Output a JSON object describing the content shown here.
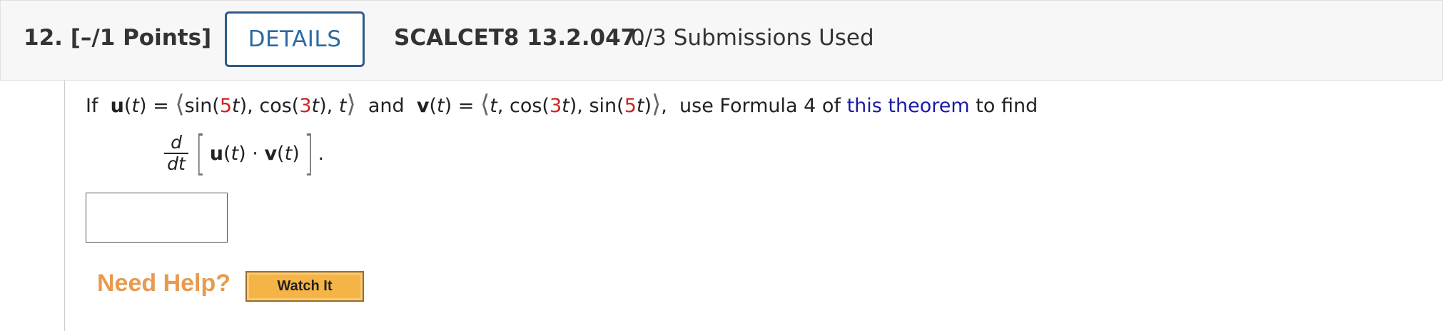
{
  "header": {
    "question_number": "12.",
    "points": "[–/1 Points]",
    "details_label": "DETAILS",
    "problem_code": "SCALCET8 13.2.047.",
    "submissions": "0/3 Submissions Used"
  },
  "problem": {
    "if_word": "If",
    "u_name": "u",
    "v_name": "v",
    "t_var": "t",
    "eq": "=",
    "sin_open": "sin(",
    "cos_open": "cos(",
    "close": ")",
    "comma": ",",
    "five": "5",
    "three": "3",
    "and_word": "and",
    "use_text": "use Formula 4 of",
    "link_text": "this theorem",
    "find_text": "to find",
    "deriv_num": "d",
    "deriv_den": "dt",
    "dot": "·",
    "period": "."
  },
  "help": {
    "need_help": "Need Help?",
    "watch_it": "Watch It"
  },
  "colors": {
    "accent_red": "#cc2222",
    "link_blue": "#1a1aa6",
    "details_blue": "#2d6aa3",
    "need_help_orange": "#e89a4e",
    "watch_button_fill": "#f5b446"
  }
}
